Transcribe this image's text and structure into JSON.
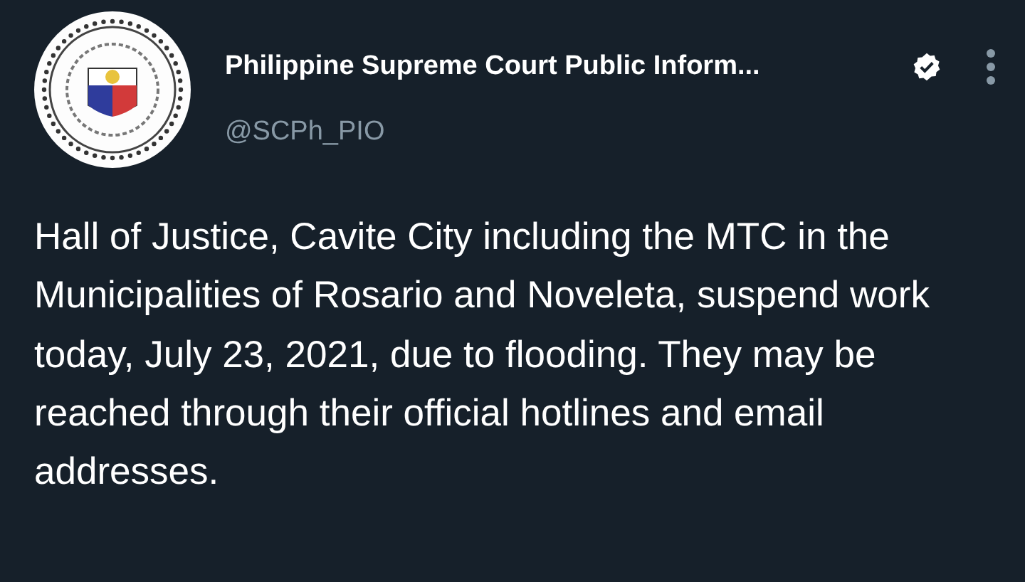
{
  "tweet": {
    "author_name": "Philippine Supreme Court Public Inform...",
    "verified": true,
    "handle": "@SCPh_PIO",
    "text": "Hall of Justice, Cavite City including the MTC in the Municipalities of Rosario and Noveleta, suspend work today, July 23, 2021, due to flooding. They may be reached through their official hotlines and email addresses."
  }
}
